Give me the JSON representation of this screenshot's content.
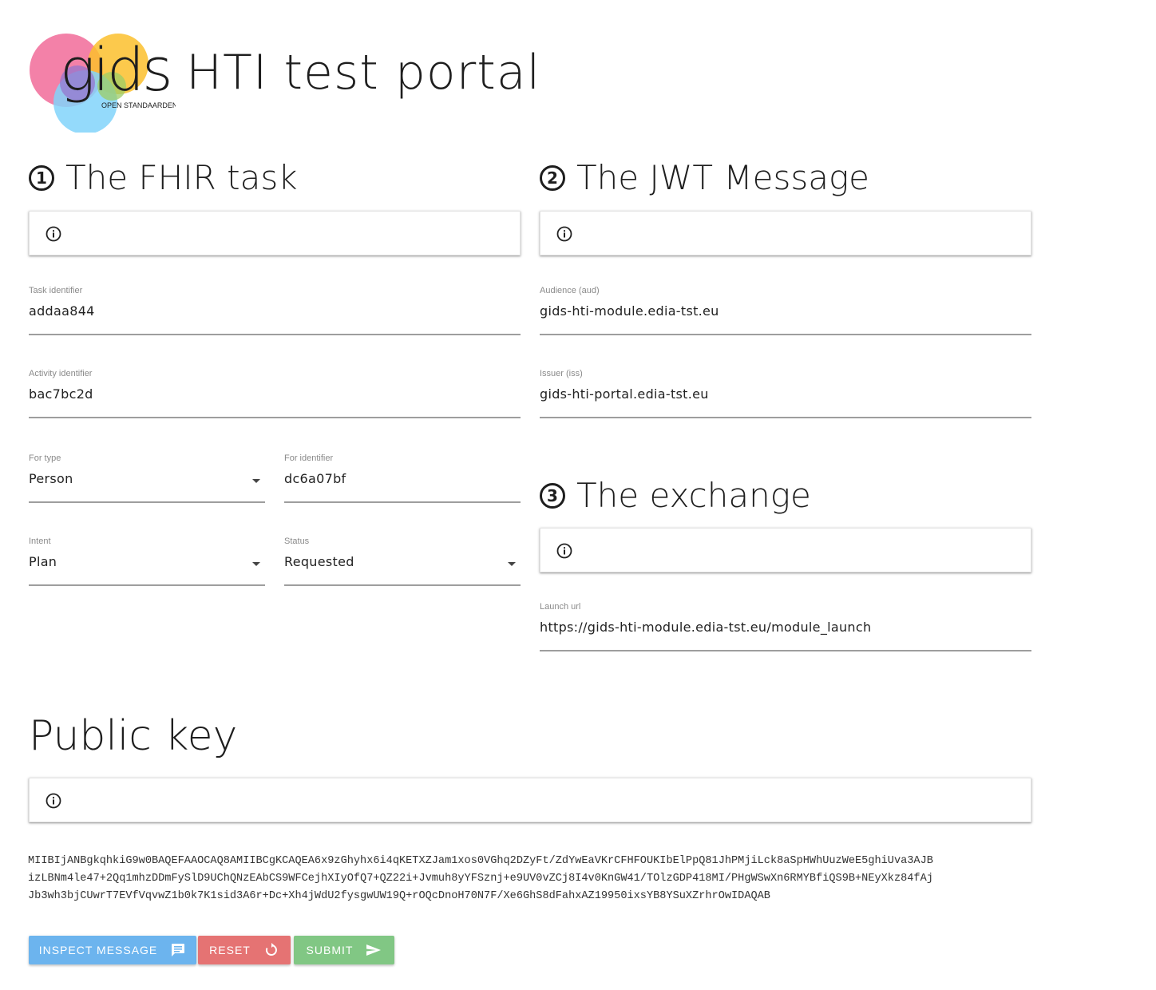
{
  "header": {
    "logo_text": "gids",
    "logo_subtext": "OPEN STANDAARDEN",
    "title": "HTI test portal"
  },
  "colors": {
    "inspect": "#6cb4ee",
    "reset": "#e57373",
    "submit": "#81c784",
    "logo_pink": "#f06292",
    "logo_yellow": "#fbc02d",
    "logo_purple": "#9575cd",
    "logo_blue": "#81d4fa",
    "logo_green": "#9ccc65"
  },
  "fhir_task": {
    "step": "1",
    "title": "The FHIR task",
    "info_icon": "info-circle-icon",
    "fields": {
      "task_identifier": {
        "label": "Task identifier",
        "value": "addaa844"
      },
      "activity_identifier": {
        "label": "Activity identifier",
        "value": "bac7bc2d"
      },
      "for_type": {
        "label": "For type",
        "value": "Person"
      },
      "for_identifier": {
        "label": "For identifier",
        "value": "dc6a07bf"
      },
      "intent": {
        "label": "Intent",
        "value": "Plan"
      },
      "status": {
        "label": "Status",
        "value": "Requested"
      }
    }
  },
  "jwt_message": {
    "step": "2",
    "title": "The JWT Message",
    "info_icon": "info-circle-icon",
    "fields": {
      "audience": {
        "label": "Audience (aud)",
        "value": "gids-hti-module.edia-tst.eu"
      },
      "issuer": {
        "label": "Issuer (iss)",
        "value": "gids-hti-portal.edia-tst.eu"
      }
    }
  },
  "exchange": {
    "step": "3",
    "title": "The exchange",
    "info_icon": "info-circle-icon",
    "fields": {
      "launch_url": {
        "label": "Launch url",
        "value": "https://gids-hti-module.edia-tst.eu/module_launch"
      }
    }
  },
  "public_key": {
    "title": "Public key",
    "info_icon": "info-circle-icon",
    "lines": [
      "MIIBIjANBgkqhkiG9w0BAQEFAAOCAQ8AMIIBCgKCAQEA6x9zGhyhx6i4qKETXZJam1xos0VGhq2DZyFt/ZdYwEaVKrCFHFOUKIbElPpQ81JhPMjiLck8aSpHWhUuzWeE5ghiUva3AJB",
      "izLBNm4le47+2Qq1mhzDDmFySlD9UChQNzEAbCS9WFCejhXIyOfQ7+QZ22i+Jvmuh8yYFSznj+e9UV0vZCj8I4v0KnGW41/TOlzGDP418MI/PHgWSwXn6RMYBfiQS9B+NEyXkz84fAj",
      "Jb3wh3bjCUwrT7EVfVqvwZ1b0k7K1sid3A6r+Dc+Xh4jWdU2fysgwUW19Q+rOQcDnoH70N7F/Xe6GhS8dFahxAZ19950ixsYB8YSuXZrhrOwIDAQAB"
    ]
  },
  "actions": {
    "inspect_label": "INSPECT MESSAGE",
    "inspect_icon": "message-icon",
    "reset_label": "RESET",
    "reset_icon": "refresh-icon",
    "submit_label": "SUBMIT",
    "submit_icon": "send-icon"
  }
}
